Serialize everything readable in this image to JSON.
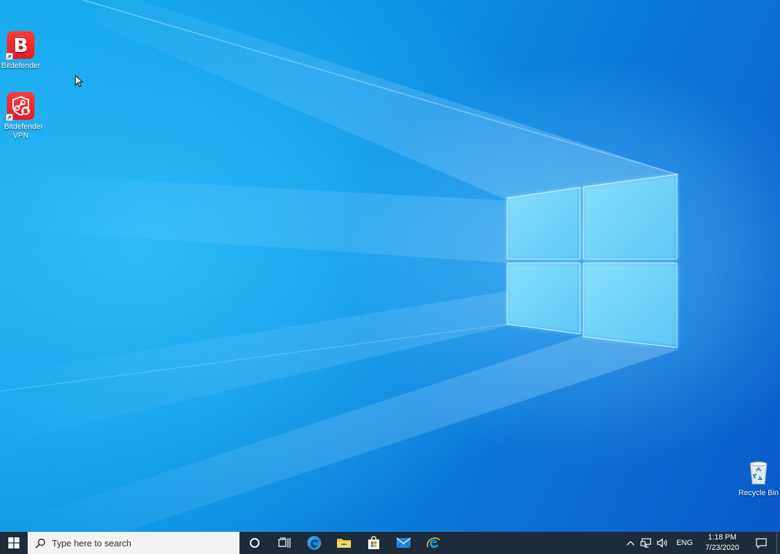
{
  "desktop": {
    "icons": [
      {
        "label": "Bitdefender",
        "icon": "bitdefender-icon"
      },
      {
        "label": "Bitdefender VPN",
        "icon": "bitdefender-vpn-icon"
      },
      {
        "label": "Recycle Bin",
        "icon": "recycle-bin-icon"
      }
    ]
  },
  "taskbar": {
    "start_icon": "windows-logo-icon",
    "search": {
      "placeholder": "Type here to search",
      "icon": "search-icon"
    },
    "apps": [
      {
        "name": "Cortana",
        "icon": "cortana-circle-icon"
      },
      {
        "name": "Task View",
        "icon": "task-view-icon"
      },
      {
        "name": "Microsoft Edge",
        "icon": "edge-icon"
      },
      {
        "name": "File Explorer",
        "icon": "folder-icon"
      },
      {
        "name": "Microsoft Store",
        "icon": "store-bag-icon"
      },
      {
        "name": "Mail",
        "icon": "mail-icon"
      },
      {
        "name": "Internet Explorer",
        "icon": "internet-explorer-icon"
      }
    ],
    "tray": {
      "language": "ENG",
      "time": "1:18 PM",
      "date": "7/23/2020"
    }
  },
  "colors": {
    "taskbar": "#1d2b3a",
    "bitdefender_red": "#e31b23",
    "desktop_blue": "#0d95e6"
  }
}
